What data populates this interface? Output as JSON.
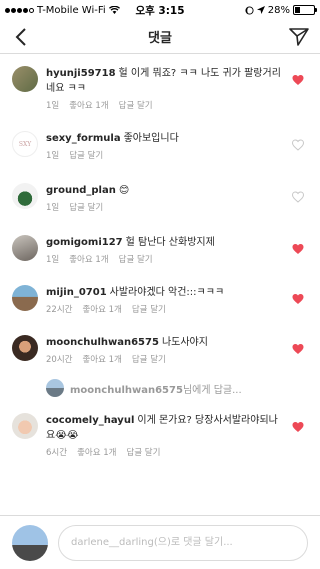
{
  "status_bar": {
    "carrier": "T-Mobile Wi-Fi",
    "time": "오후 3:15",
    "battery": "28%",
    "battery_level": 0.28
  },
  "header": {
    "title": "댓글",
    "back_icon": "chevron-left-icon",
    "send_icon": "paper-plane-icon"
  },
  "comments": [
    {
      "username": "hyunji59718",
      "text": "헐 이게 뭐죠? ㅋㅋ 나도 귀가 팔랑거리네요 ㅋㅋ",
      "time": "1일",
      "likes": "좋아요 1개",
      "reply": "답글 달기",
      "liked": true
    },
    {
      "username": "sexy_formula",
      "text": "좋아보입니다",
      "time": "1일",
      "likes": "",
      "reply": "답글 달기",
      "liked": false
    },
    {
      "username": "ground_plan",
      "text": "😊",
      "time": "1일",
      "likes": "",
      "reply": "답글 달기",
      "liked": false
    },
    {
      "username": "gomigomi127",
      "text": "헐 탐난다 산화방지제",
      "time": "1일",
      "likes": "좋아요 1개",
      "reply": "답글 달기",
      "liked": true
    },
    {
      "username": "mijin_0701",
      "text": "사발라야겠다 악건:::ㅋㅋㅋ",
      "time": "22시간",
      "likes": "좋아요 1개",
      "reply": "답글 달기",
      "liked": true
    },
    {
      "username": "moonchulhwan6575",
      "text": "나도사야지",
      "time": "20시간",
      "likes": "좋아요 1개",
      "reply": "답글 달기",
      "liked": true
    },
    {
      "username": "cocomely_hayul",
      "text": "이게 몬가요? 당장사서발라야되나요😭😭",
      "time": "6시간",
      "likes": "좋아요 1개",
      "reply": "답글 달기",
      "liked": true
    }
  ],
  "reply_prompt": {
    "username": "moonchulhwan6575",
    "suffix": "님에게 답글..."
  },
  "footer": {
    "placeholder": "darlene__darling(으)로 댓글 달기..."
  },
  "colors": {
    "heart_active": "#ed4956",
    "heart_inactive": "#c7c7c7",
    "meta": "#999999",
    "divider": "#dbdbdb"
  }
}
